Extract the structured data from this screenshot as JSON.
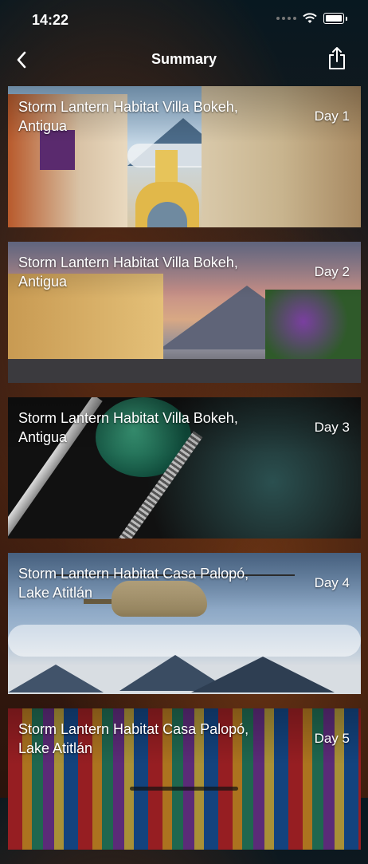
{
  "status_bar": {
    "time": "14:22"
  },
  "nav": {
    "title": "Summary"
  },
  "trips": [
    {
      "title": "Storm Lantern Habitat Villa Bokeh, Antigua",
      "day": "Day 1"
    },
    {
      "title": "Storm Lantern Habitat Villa Bokeh, Antigua",
      "day": "Day 2"
    },
    {
      "title": "Storm Lantern Habitat Villa Bokeh, Antigua",
      "day": "Day 3"
    },
    {
      "title": "Storm Lantern Habitat Casa Palopó, Lake Atitlán",
      "day": "Day 4"
    },
    {
      "title": "Storm Lantern Habitat Casa Palopó, Lake Atitlán",
      "day": "Day 5"
    }
  ],
  "icons": {
    "back": "chevron-left-icon",
    "share": "share-icon",
    "wifi": "wifi-icon",
    "battery": "battery-icon",
    "signal": "signal-icon"
  }
}
